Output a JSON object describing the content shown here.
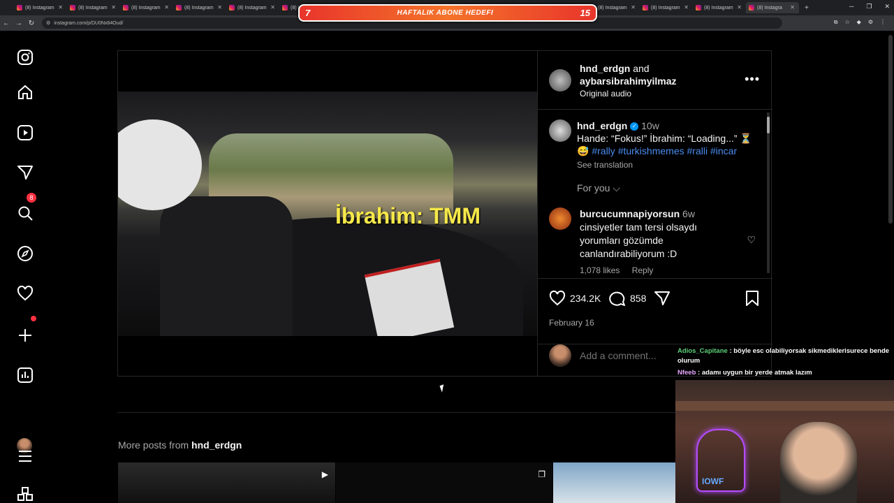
{
  "browser": {
    "tabs": [
      "(8) Instagram",
      "(8) Instagram",
      "(8) Instagram",
      "(8) Instagram",
      "(8) Instagram",
      "(8) Instagram",
      "(8) Instagram",
      "(8) Instagram",
      "(8) Instagram",
      "(8) Instagram",
      "(8) Instagram",
      "(8) Instagram",
      "(8) Instagram",
      "(8) Instagram"
    ],
    "active_tab": "(8) Instagra",
    "url": "instagram.com/p/DU0Nx64Oud/"
  },
  "banner": {
    "number_left": "7",
    "title": "HAFTALIK ABONE HEDEFI",
    "number_right": "15"
  },
  "sidebar": {
    "notification_count": "8"
  },
  "post": {
    "caption_overlay": "İbrahim: TMM",
    "author_1": "hnd_erdgn",
    "and_text": "and",
    "author_2": "aybarsibrahimyilmaz",
    "audio": "Original audio",
    "comment1": {
      "user": "hnd_erdgn",
      "time": "10w",
      "text": "Hande: “Fokus!” İbrahim: “Loading...” ⏳",
      "emoji": "😅",
      "tags": [
        "#rally",
        "#turkishmemes",
        "#ralli",
        "#incar"
      ],
      "see_translation": "See translation"
    },
    "for_you": "For you",
    "comment2": {
      "user": "burcucumnapiyorsun",
      "time": "6w",
      "text": "cinsiyetler tam tersi olsaydı yorumları gözümde canlandırabiliyorum :D",
      "likes": "1,078 likes",
      "reply": "Reply"
    },
    "likes": "234.2K",
    "comments_count": "858",
    "date": "February 16",
    "add_comment_placeholder": "Add a comment..."
  },
  "more_posts": {
    "prefix": "More posts from",
    "user": "hnd_erdgn"
  },
  "chat": [
    {
      "user": "Adios_Capitane",
      "text": ": böyle esc olabiliyorsak sikmediklerisurece bende olurum"
    },
    {
      "user": "Nfeeb",
      "text": ": adamı uygun bir yerde atmak lazım"
    }
  ],
  "webcam": {
    "neon_text": "IOWF"
  }
}
